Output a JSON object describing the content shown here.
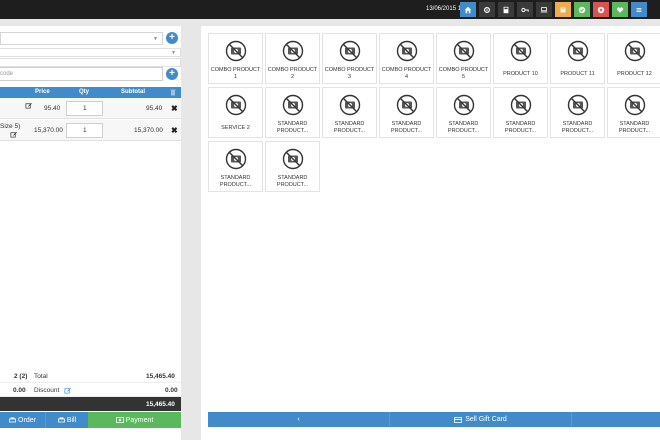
{
  "topbar": {
    "datetime": "13/06/2015 11:22",
    "buttons": [
      {
        "name": "home-icon",
        "color": "#428bca"
      },
      {
        "name": "settings-icon",
        "color": "#3a3a3a"
      },
      {
        "name": "calculator-icon",
        "color": "#3a3a3a"
      },
      {
        "name": "key-icon",
        "color": "#3a3a3a"
      },
      {
        "name": "laptop-icon",
        "color": "#3a3a3a"
      },
      {
        "name": "register-icon",
        "color": "#f0ad4e"
      },
      {
        "name": "check-icon",
        "color": "#5cb85c"
      },
      {
        "name": "close-icon",
        "color": "#d9534f"
      },
      {
        "name": "heart-icon",
        "color": "#5cb85c"
      },
      {
        "name": "menu-icon",
        "color": "#428bca"
      }
    ]
  },
  "order": {
    "barcode_placeholder": "code",
    "columns": {
      "price": "Price",
      "qty": "Qty",
      "subtotal": "Subtotal"
    },
    "items": [
      {
        "name": "",
        "price": "95.40",
        "qty": "1",
        "subtotal": "95.40"
      },
      {
        "name": "Size 5)",
        "price": "15,370.00",
        "qty": "1",
        "subtotal": "15,370.00"
      }
    ],
    "items_count": "2 (2)",
    "total_label": "Total",
    "total_value": "15,465.40",
    "discount_count": "0.00",
    "discount_label": "Discount",
    "discount_value": "0.00",
    "grand_total": "15,465.40",
    "actions": {
      "order": "Order",
      "bill": "Bill",
      "payment": "Payment"
    }
  },
  "products": [
    "COMBO PRODUCT 1",
    "COMBO PRODUCT 2",
    "COMBO PRODUCT 3",
    "COMBO PRODUCT 4",
    "COMBO PRODUCT 5",
    "PRODUCT 10",
    "PRODUCT 11",
    "PRODUCT 12",
    "SERVICE 2",
    "STANDARD PRODUCT...",
    "STANDARD PRODUCT...",
    "STANDARD PRODUCT...",
    "STANDARD PRODUCT...",
    "STANDARD PRODUCT...",
    "STANDARD PRODUCT...",
    "STANDARD PRODUCT...",
    "STANDARD PRODUCT...",
    "STANDARD PRODUCT..."
  ],
  "bottom": {
    "prev": "‹",
    "gift": "Sell Gift Card"
  },
  "colors": {
    "primary": "#428bca",
    "success": "#5cb85c",
    "dark": "#333333"
  }
}
